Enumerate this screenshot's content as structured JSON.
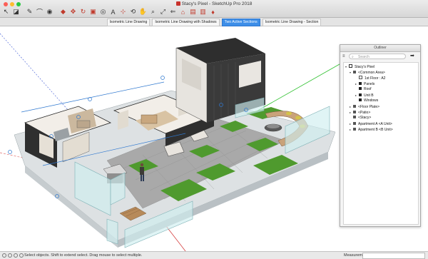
{
  "window": {
    "title": "Stacy's Pixel - SketchUp Pro 2018",
    "traffic_colors": [
      "#fc5f57",
      "#fdbc2e",
      "#28c840"
    ]
  },
  "toolbar": {
    "tools": [
      "select-icon",
      "eraser-icon",
      "pencil-icon",
      "arc-icon",
      "paint-bucket-icon",
      "push-pull-icon",
      "move-icon",
      "rotate-icon",
      "scale-icon",
      "tape-measure-icon",
      "text-icon",
      "axes-icon",
      "orbit-icon",
      "pan-icon",
      "zoom-icon",
      "zoom-extents-icon",
      "previous-view-icon",
      "warehouse-icon",
      "extension-warehouse-icon",
      "layout-icon",
      "ruby-icon"
    ]
  },
  "scene_tabs": [
    {
      "label": "Isometric Line Drawing",
      "active": false
    },
    {
      "label": "Isometric Line Drawing with Shadows",
      "active": false
    },
    {
      "label": "Two Active Sections",
      "active": true
    },
    {
      "label": "Isometric Line Drawing - Section",
      "active": false
    }
  ],
  "outliner": {
    "title": "Outliner",
    "search_placeholder": "Search",
    "rows": [
      {
        "label": "Stacy's Pixel",
        "indent": 0,
        "arrow": "▾",
        "icon": "model"
      },
      {
        "label": "<Common Area>",
        "indent": 1,
        "arrow": "▾",
        "icon": "comp"
      },
      {
        "label": "1st Floor : A2",
        "indent": 2,
        "arrow": "",
        "icon": "section"
      },
      {
        "label": "Panels",
        "indent": 2,
        "arrow": "▸",
        "icon": "group"
      },
      {
        "label": "Roof",
        "indent": 2,
        "arrow": "",
        "icon": "group"
      },
      {
        "label": "Unit B",
        "indent": 2,
        "arrow": "▸",
        "icon": "group"
      },
      {
        "label": "Windows",
        "indent": 2,
        "arrow": "",
        "icon": "group"
      },
      {
        "label": "<Floor Plate>",
        "indent": 1,
        "arrow": "▸",
        "icon": "comp"
      },
      {
        "label": "<Patio>",
        "indent": 1,
        "arrow": "▸",
        "icon": "comp"
      },
      {
        "label": "<Stacy>",
        "indent": 1,
        "arrow": "",
        "icon": "comp"
      },
      {
        "label": "Apartment A <A Unit>",
        "indent": 1,
        "arrow": "▸",
        "icon": "comp"
      },
      {
        "label": "Apartment B <B Unit>",
        "indent": 1,
        "arrow": "▸",
        "icon": "comp"
      }
    ]
  },
  "status": {
    "message": "Select objects. Shift to extend select. Drag mouse to select multiple.",
    "measurements_label": "Measurements",
    "measurements_value": ""
  },
  "colors": {
    "accent_tab": "#3d8ee8",
    "axis_green": "#2ec02e",
    "axis_red": "#d43a3a",
    "axis_blue": "#3a55d4",
    "grass": "#4f9a2e",
    "glass": "#cfeef0",
    "paving": "#a8a8a8",
    "wood": "#b78a5a",
    "dark_cladding": "#3a3a3a"
  }
}
